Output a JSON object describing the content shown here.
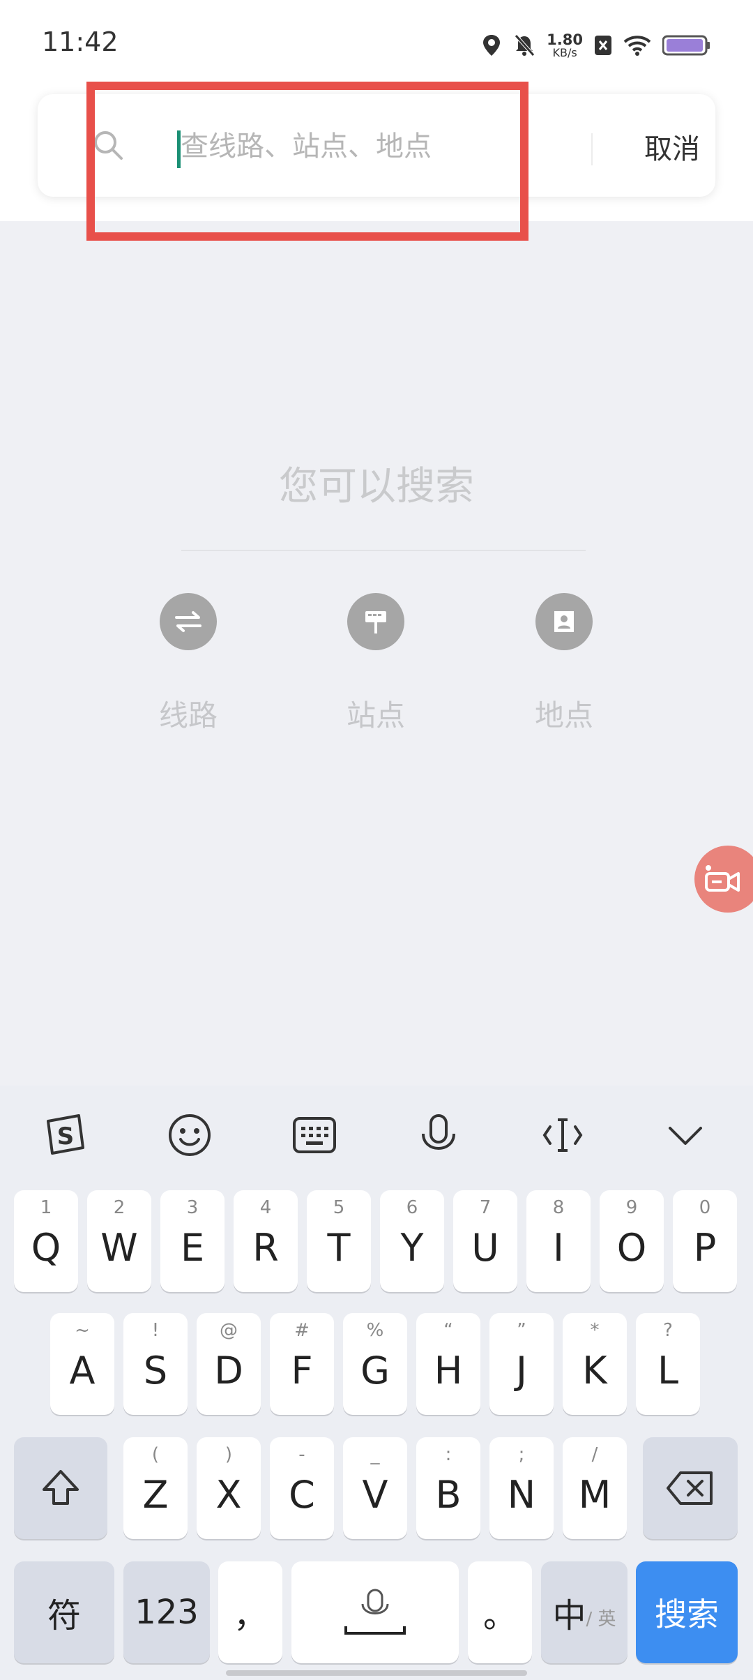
{
  "status_bar": {
    "time": "11:42",
    "net_speed_value": "1.80",
    "net_speed_unit": "KB/s",
    "icons": [
      "location-icon",
      "mute-icon",
      "net-speed",
      "sim-icon",
      "wifi-icon",
      "battery-icon"
    ]
  },
  "search": {
    "placeholder": "查线路、站点、地点",
    "value": "",
    "cancel_label": "取消"
  },
  "hint": {
    "title": "您可以搜索",
    "options": [
      {
        "label": "线路",
        "icon": "route-arrows-icon"
      },
      {
        "label": "站点",
        "icon": "bus-stop-sign-icon"
      },
      {
        "label": "地点",
        "icon": "location-pin-icon"
      }
    ]
  },
  "floating_button": {
    "icon": "video-recorder-icon"
  },
  "keyboard": {
    "toolbar_icons": [
      "sogou-logo-icon",
      "emoji-icon",
      "keyboard-icon",
      "microphone-icon",
      "cursor-move-icon",
      "collapse-icon"
    ],
    "row1": [
      {
        "main": "Q",
        "sub": "1"
      },
      {
        "main": "W",
        "sub": "2"
      },
      {
        "main": "E",
        "sub": "3"
      },
      {
        "main": "R",
        "sub": "4"
      },
      {
        "main": "T",
        "sub": "5"
      },
      {
        "main": "Y",
        "sub": "6"
      },
      {
        "main": "U",
        "sub": "7"
      },
      {
        "main": "I",
        "sub": "8"
      },
      {
        "main": "O",
        "sub": "9"
      },
      {
        "main": "P",
        "sub": "0"
      }
    ],
    "row2": [
      {
        "main": "A",
        "sub": "~"
      },
      {
        "main": "S",
        "sub": "!"
      },
      {
        "main": "D",
        "sub": "@"
      },
      {
        "main": "F",
        "sub": "#"
      },
      {
        "main": "G",
        "sub": "%"
      },
      {
        "main": "H",
        "sub": "“"
      },
      {
        "main": "J",
        "sub": "”"
      },
      {
        "main": "K",
        "sub": "*"
      },
      {
        "main": "L",
        "sub": "?"
      }
    ],
    "row3": [
      {
        "main": "Z",
        "sub": "("
      },
      {
        "main": "X",
        "sub": ")"
      },
      {
        "main": "C",
        "sub": "-"
      },
      {
        "main": "V",
        "sub": "_"
      },
      {
        "main": "B",
        "sub": ":"
      },
      {
        "main": "N",
        "sub": ";"
      },
      {
        "main": "M",
        "sub": "/"
      }
    ],
    "symbol_label": "符",
    "numeric_label": "123",
    "comma_label": "，",
    "period_label": "。",
    "lang_main": "中",
    "lang_sub": "/ 英",
    "search_label": "搜索"
  }
}
